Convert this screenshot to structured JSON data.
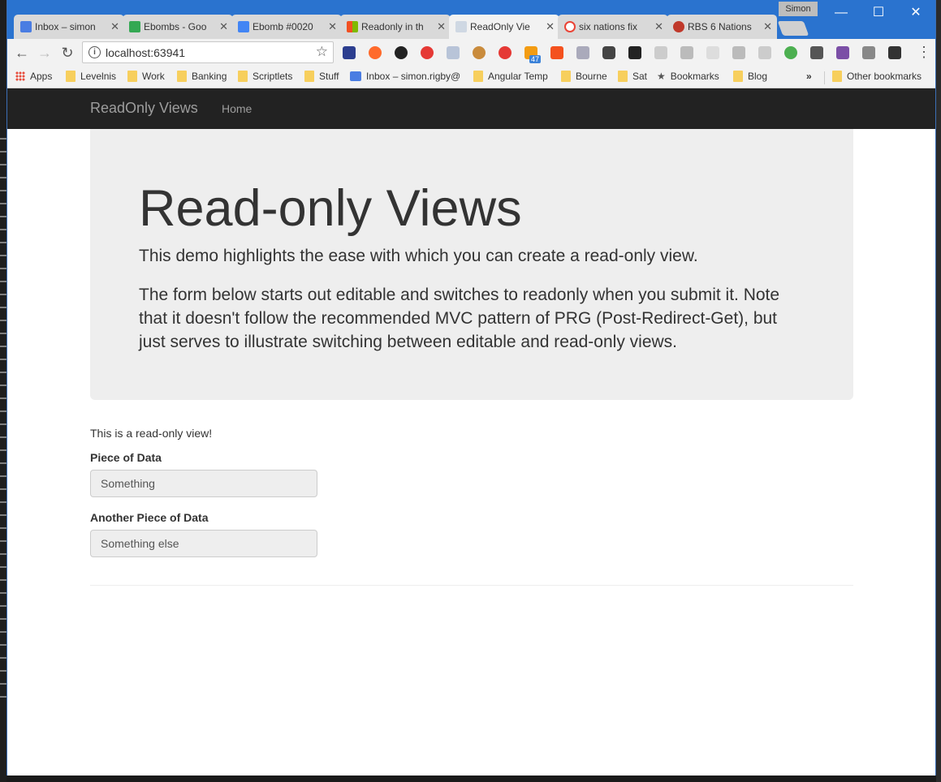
{
  "browser": {
    "profile_name": "Simon",
    "tabs": [
      {
        "title": "Inbox – simon",
        "favicon": "#4a7de2"
      },
      {
        "title": "Ebombs - Goo",
        "favicon": "#34a853"
      },
      {
        "title": "Ebomb #0020",
        "favicon": "#4285f4"
      },
      {
        "title": "Readonly in th",
        "favicon": "#f25022"
      },
      {
        "title": "ReadOnly Vie",
        "favicon": "#cfd8e3"
      },
      {
        "title": "six nations fix",
        "favicon": "#ea4335"
      },
      {
        "title": "RBS 6 Nations",
        "favicon": "#c0392b"
      }
    ],
    "address": "localhost:63941",
    "bookmarks": [
      {
        "label": "Apps",
        "icon": "apps-icon"
      },
      {
        "label": "Levelnis",
        "icon": "folder-icon"
      },
      {
        "label": "Work",
        "icon": "folder-icon"
      },
      {
        "label": "Banking",
        "icon": "folder-icon"
      },
      {
        "label": "Scriptlets",
        "icon": "folder-icon"
      },
      {
        "label": "Stuff",
        "icon": "folder-icon"
      },
      {
        "label": "Inbox – simon.rigby@",
        "icon": "inbox-icon"
      },
      {
        "label": "Angular Temp",
        "icon": "folder-icon"
      },
      {
        "label": "Bourne",
        "icon": "folder-icon"
      },
      {
        "label": "Sat",
        "icon": "folder-icon"
      },
      {
        "label": "Bookmarks",
        "icon": "star-icon"
      },
      {
        "label": "Blog",
        "icon": "folder-icon"
      }
    ],
    "overflow_label": "»",
    "other_bookmarks": "Other bookmarks",
    "rss_badge": "47"
  },
  "navbar": {
    "brand": "ReadOnly Views",
    "home": "Home"
  },
  "jumbotron": {
    "title": "Read-only Views",
    "lead": "This demo highlights the ease with which you can create a read-only view.",
    "description": "The form below starts out editable and switches to readonly when you submit it. Note that it doesn't follow the recommended MVC pattern of PRG (Post-Redirect-Get), but just serves to illustrate switching between editable and read-only views."
  },
  "form": {
    "note": "This is a read-only view!",
    "field1": {
      "label": "Piece of Data",
      "value": "Something"
    },
    "field2": {
      "label": "Another Piece of Data",
      "value": "Something else"
    }
  }
}
